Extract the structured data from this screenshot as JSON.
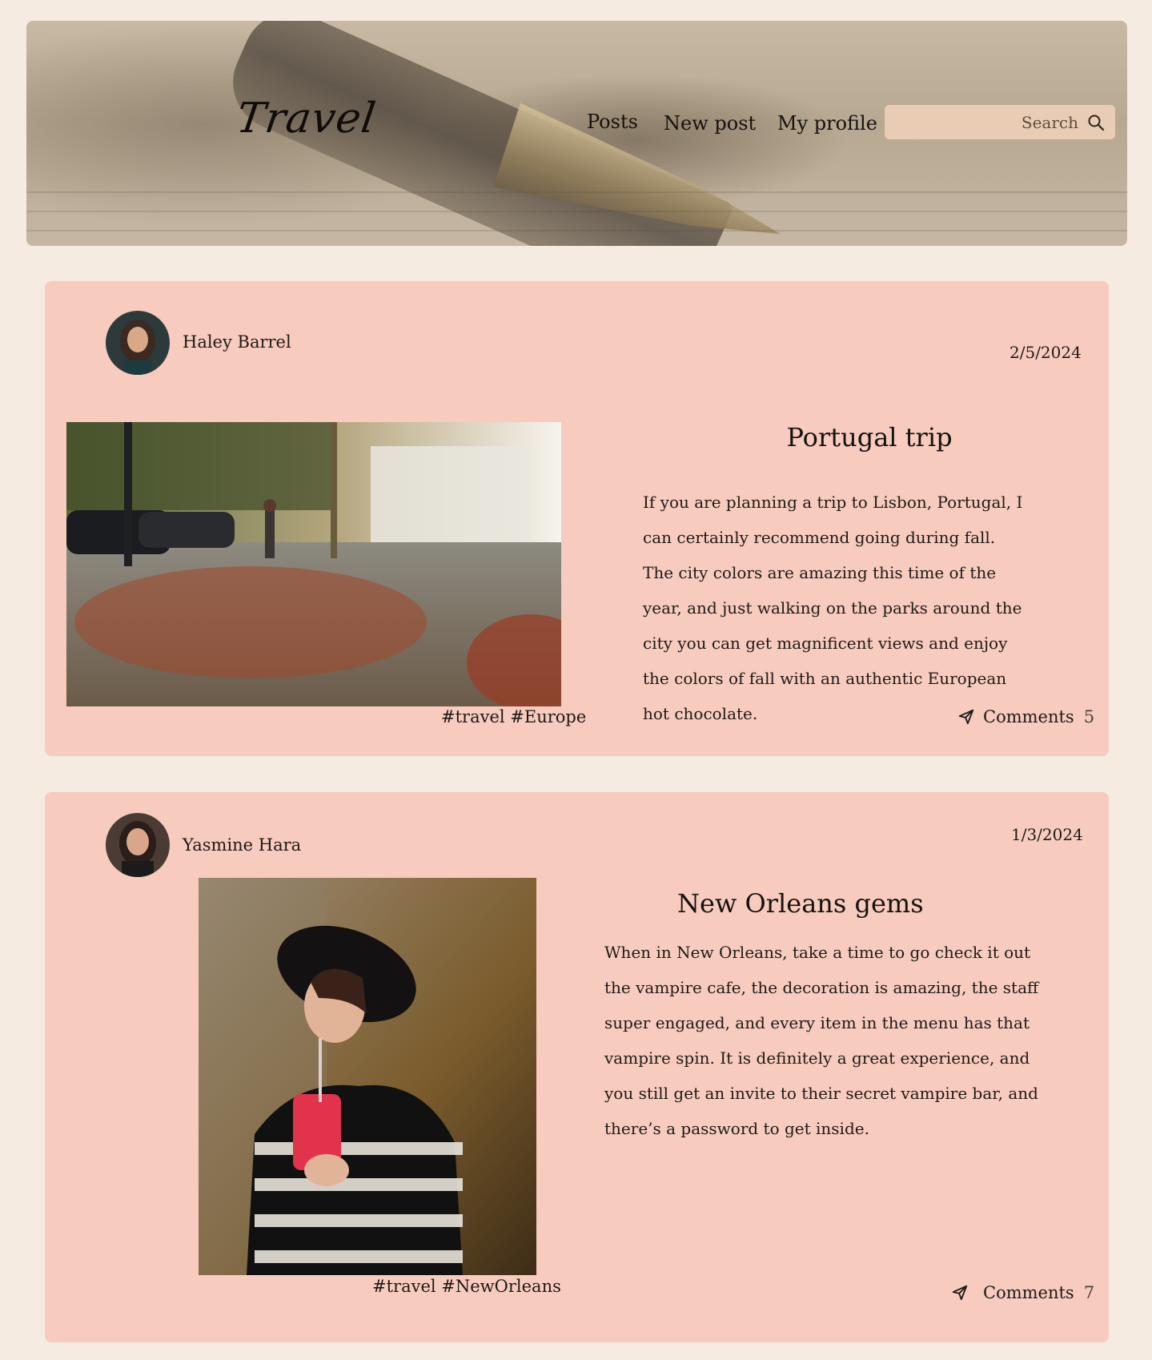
{
  "header": {
    "logo": "Travel",
    "nav": {
      "posts": "Posts",
      "new_post": "New post",
      "my_profile": "My profile"
    },
    "search": {
      "placeholder": "Search",
      "icon": "search-icon"
    }
  },
  "posts": [
    {
      "author": "Haley Barrel",
      "date": "2/5/2024",
      "title": "Portugal trip",
      "body": "If you are planning a trip to Lisbon, Portugal, I can certainly recommend going during fall. The city colors are amazing this time of the year, and just walking on the parks around the city you can get magnificent views and enjoy the colors of fall with an authentic European hot chocolate.",
      "tags": "#travel #Europe",
      "comments_label": "Comments",
      "comments_count": "5"
    },
    {
      "author": "Yasmine Hara",
      "date": "1/3/2024",
      "title": "New Orleans gems",
      "body": "When in New Orleans, take a time to go check it out the vampire cafe, the decoration is amazing, the staff super engaged, and every item in the menu has that vampire spin. It is definitely a great experience, and you still get an invite to their secret vampire bar, and there’s a password to get inside.",
      "tags": "#travel #NewOrleans",
      "comments_label": "Comments",
      "comments_count": "7"
    }
  ],
  "colors": {
    "page_bg": "#f6ebe1",
    "card_bg": "#f7cbbe",
    "search_bg": "#e8cdb4"
  }
}
